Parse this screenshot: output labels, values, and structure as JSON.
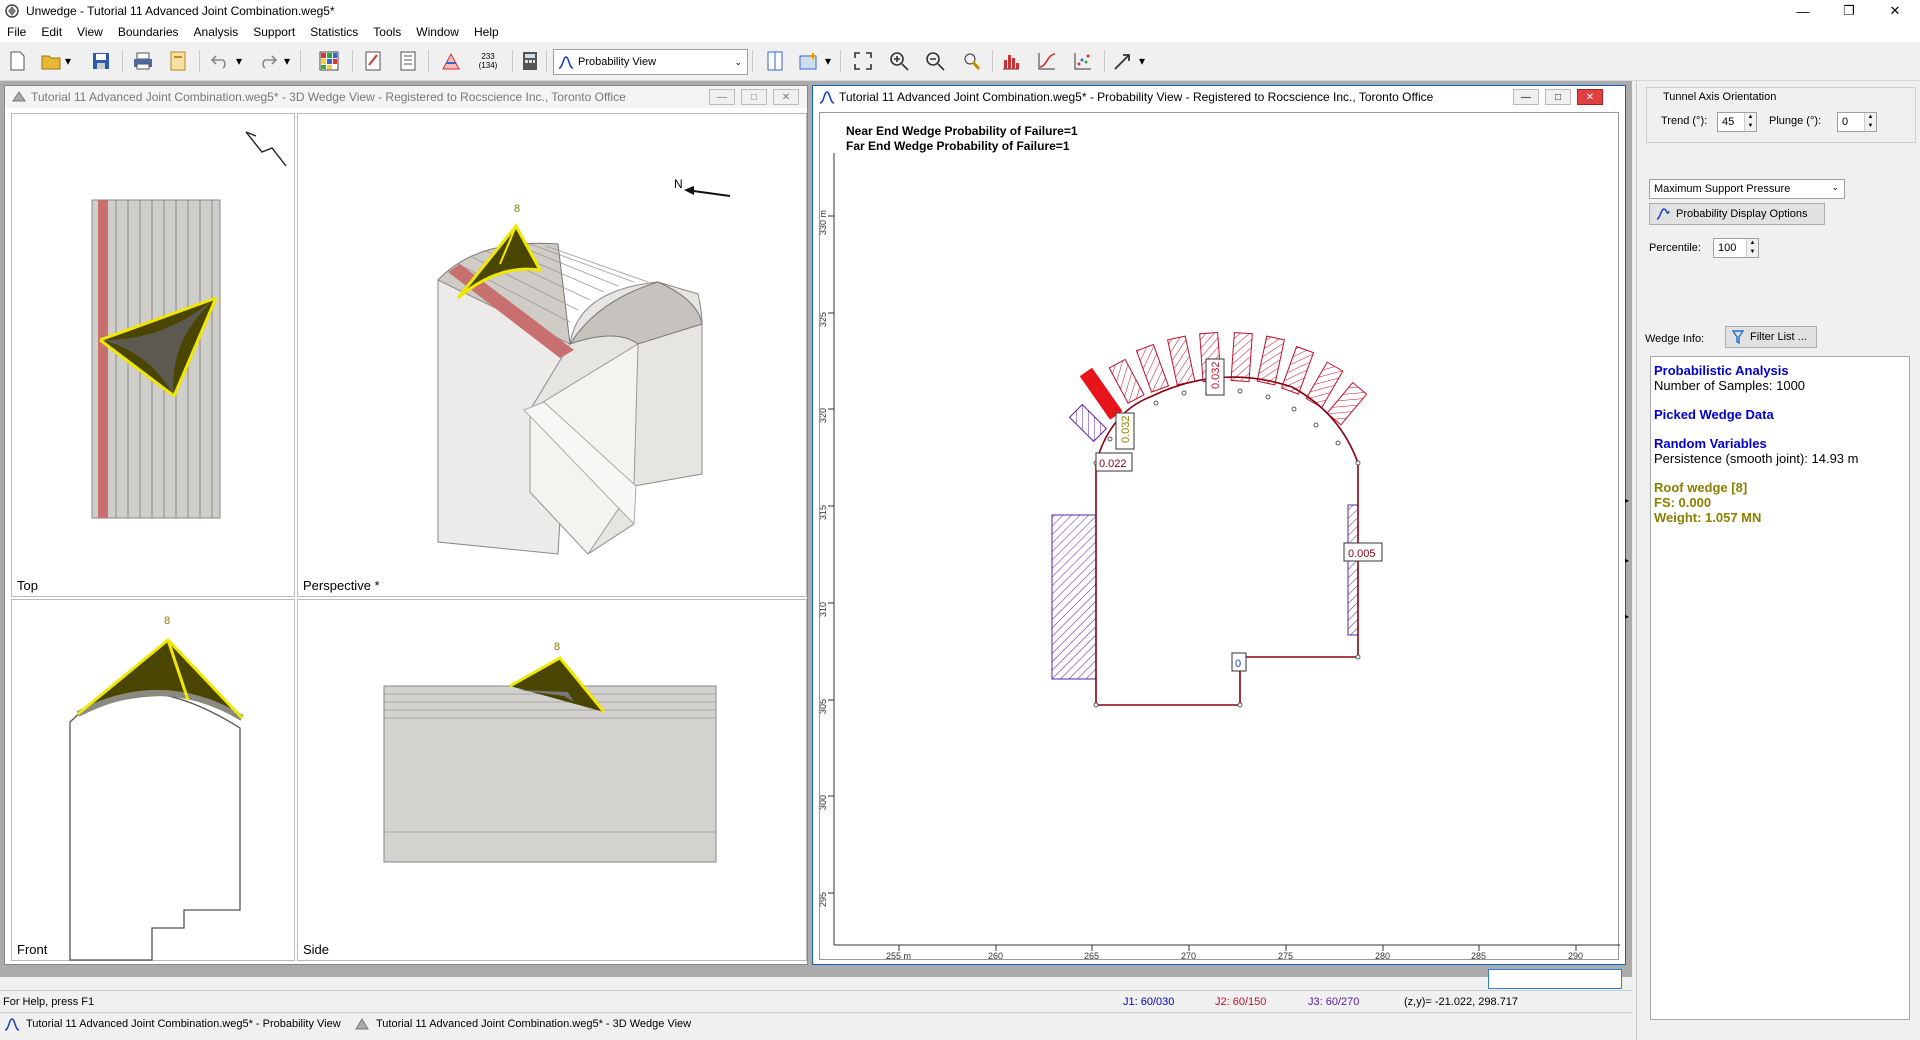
{
  "window": {
    "title": "Unwedge - Tutorial 11 Advanced Joint Combination.weg5*"
  },
  "menu": [
    "File",
    "Edit",
    "View",
    "Boundaries",
    "Analysis",
    "Support",
    "Statistics",
    "Tools",
    "Window",
    "Help"
  ],
  "toolbar": {
    "view_select": "Probability View",
    "badge_top": "233",
    "badge_bottom": "(134)"
  },
  "wedge_window": {
    "title": "Tutorial 11 Advanced Joint Combination.weg5* - 3D Wedge View - Registered to Rocscience Inc., Toronto Office",
    "views": {
      "top": "Top",
      "perspective": "Perspective *",
      "front": "Front",
      "side": "Side"
    },
    "wedge_id": "8",
    "north": "N"
  },
  "prob_window": {
    "title": "Tutorial 11 Advanced Joint Combination.weg5* - Probability View - Registered to Rocscience Inc., Toronto Office",
    "near_end": "Near End Wedge Probability of Failure=1",
    "far_end": "Far End Wedge Probability of Failure=1",
    "labels": [
      "0.032",
      "0.032",
      "0.022",
      "0.005",
      "0"
    ],
    "x_ticks": [
      "255 m",
      "260",
      "265",
      "270",
      "275",
      "280",
      "285",
      "290"
    ],
    "y_ticks": [
      "330 m",
      "325",
      "320",
      "315",
      "310",
      "305",
      "300",
      "295"
    ]
  },
  "sidepanel": {
    "axis_title": "Tunnel Axis Orientation",
    "trend_label": "Trend (°):",
    "trend_value": "45",
    "plunge_label": "Plunge (°):",
    "plunge_value": "0",
    "display_select": "Maximum Support Pressure",
    "options_button": "Probability Display Options",
    "percentile_label": "Percentile:",
    "percentile_value": "100",
    "wedge_info_label": "Wedge Info:",
    "filter_button": "Filter List ...",
    "info": {
      "h1": "Probabilistic Analysis",
      "r1": "Number of Samples: 1000",
      "h2": "Picked Wedge Data",
      "h3": "Random Variables",
      "r3": "Persistence (smooth joint): 14.93 m",
      "w1": "Roof wedge [8]",
      "w2": "FS: 0.000",
      "w3": "Weight: 1.057 MN"
    }
  },
  "status": {
    "help": "For Help, press F1",
    "j1": "J1: 60/030",
    "j2": "J2: 60/150",
    "j3": "J3: 60/270",
    "coords": "(z,y)= -21.022, 298.717"
  },
  "taskbar": {
    "item1": "Tutorial 11 Advanced Joint Combination.weg5* - Probability View",
    "item2": "Tutorial 11 Advanced Joint Combination.weg5* - 3D Wedge View"
  },
  "colors": {
    "wedge": "#4a4500",
    "joint": "#f0e800",
    "hatch_red": "#c0102a",
    "hatch_purple": "#5a20a0",
    "axis_blue": "#0000cc"
  }
}
